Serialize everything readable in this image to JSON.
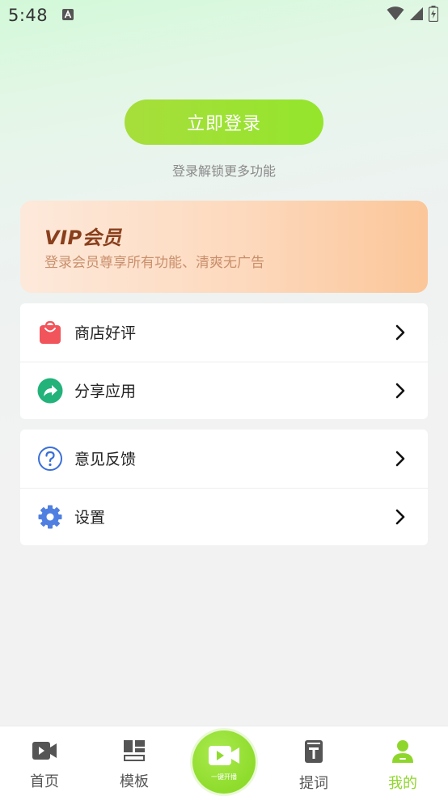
{
  "status_bar": {
    "time": "5:48",
    "icons": [
      "a-badge-icon",
      "wifi-icon",
      "signal-icon",
      "battery-icon"
    ]
  },
  "login": {
    "button_label": "立即登录",
    "hint": "登录解锁更多功能"
  },
  "vip": {
    "title": "VIP会员",
    "subtitle": "登录会员尊享所有功能、清爽无广告"
  },
  "menu_groups": [
    {
      "items": [
        {
          "label": "商店好评",
          "icon": "shopping-bag-icon"
        },
        {
          "label": "分享应用",
          "icon": "share-icon"
        }
      ]
    },
    {
      "items": [
        {
          "label": "意见反馈",
          "icon": "question-icon"
        },
        {
          "label": "设置",
          "icon": "gear-icon"
        }
      ]
    }
  ],
  "bottom_nav": {
    "items": [
      {
        "label": "首页",
        "icon": "video-camera-icon"
      },
      {
        "label": "模板",
        "icon": "template-icon"
      },
      {
        "label": "提词",
        "icon": "teleprompter-icon"
      },
      {
        "label": "我的",
        "icon": "user-icon"
      }
    ],
    "center": {
      "label": "一键开播",
      "icon": "video-camera-icon"
    },
    "active": "我的"
  },
  "colors": {
    "accent": "#94e52c",
    "vip_title": "#8a3f1c",
    "vip_subtitle": "#c98f6c",
    "active_nav": "#8fd62c"
  }
}
